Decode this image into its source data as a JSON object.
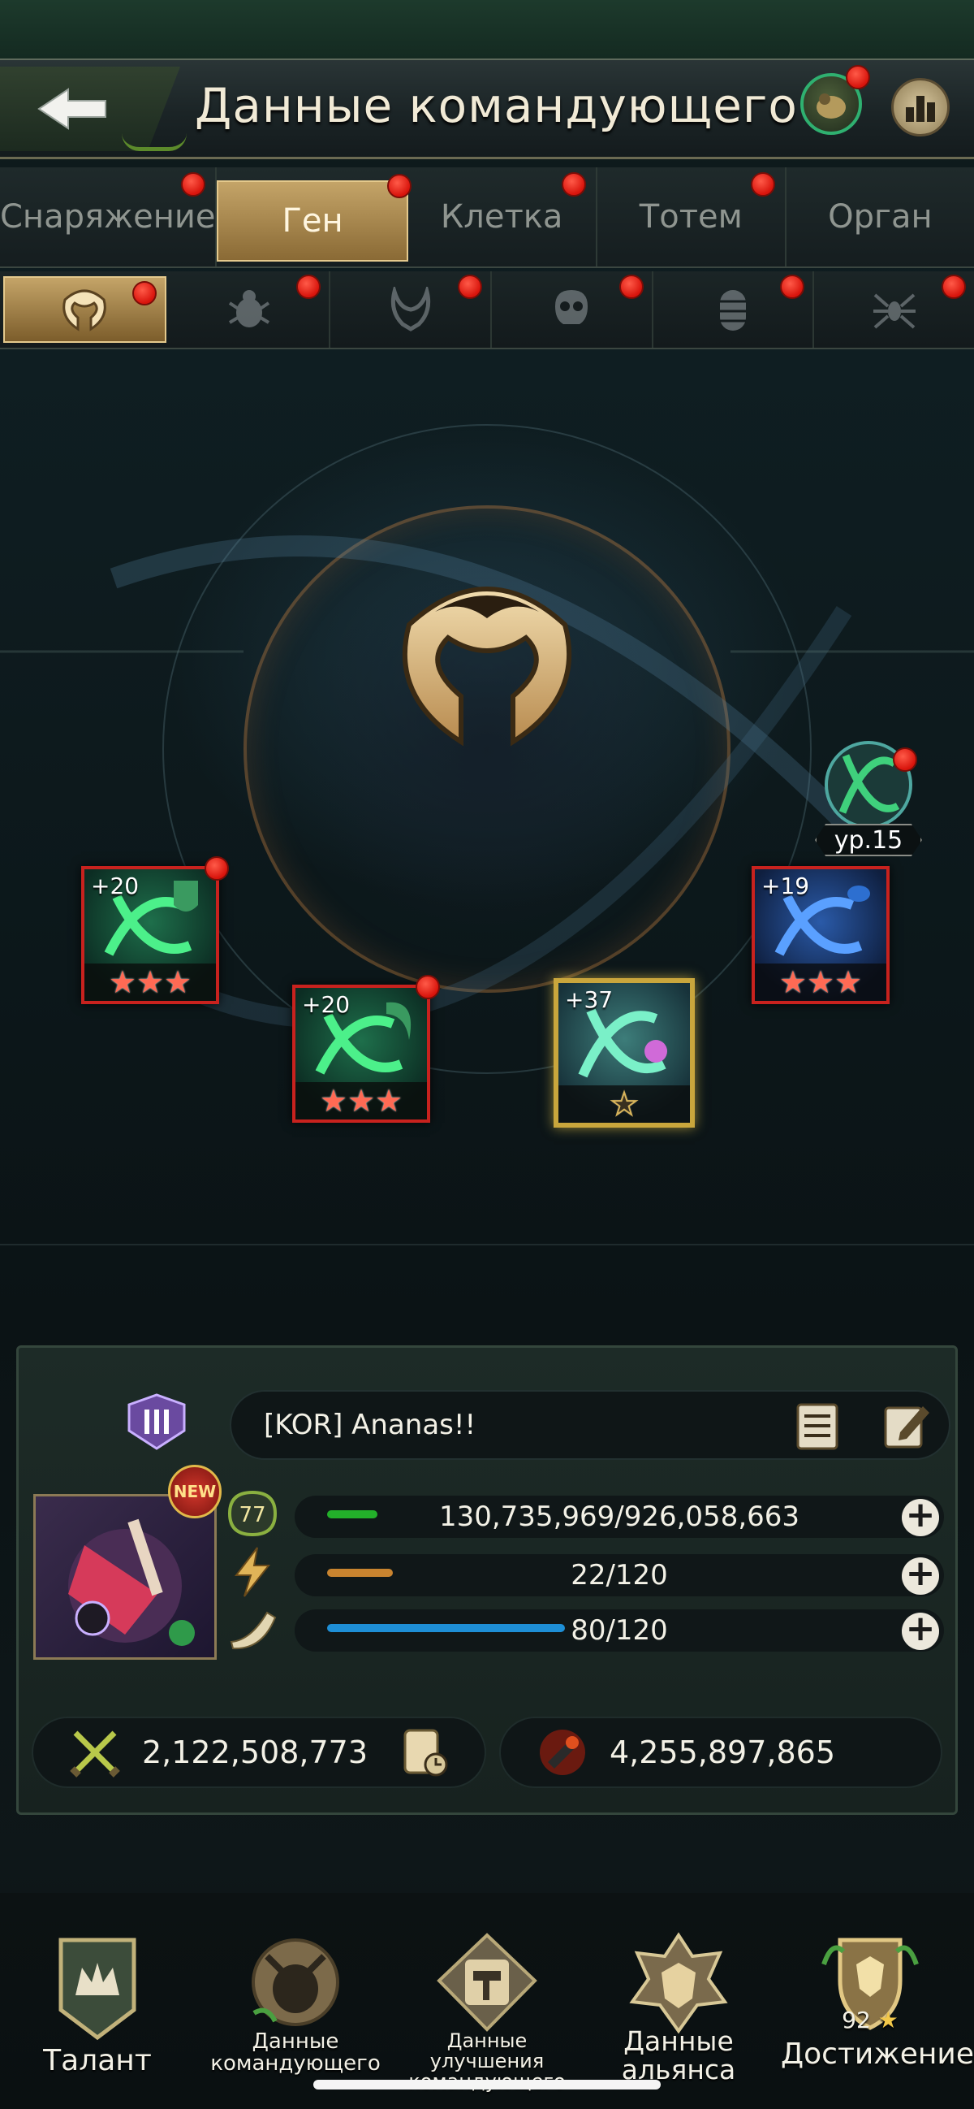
{
  "header": {
    "title": "Данные командующего"
  },
  "tabs": [
    {
      "label": "Снаряжение",
      "active": false,
      "badge": true
    },
    {
      "label": "Ген",
      "active": true,
      "badge": true
    },
    {
      "label": "Клетка",
      "active": false,
      "badge": true
    },
    {
      "label": "Тотем",
      "active": false,
      "badge": true
    },
    {
      "label": "Орган",
      "active": false,
      "badge": false
    }
  ],
  "subtabs": [
    {
      "icon": "gene-emblem-icon",
      "active": true
    },
    {
      "icon": "beetle-icon",
      "active": false
    },
    {
      "icon": "mantis-head-icon",
      "active": false
    },
    {
      "icon": "skull-ant-icon",
      "active": false
    },
    {
      "icon": "larva-icon",
      "active": false
    },
    {
      "icon": "spider-icon",
      "active": false
    }
  ],
  "gene_level": {
    "label": "ур.15"
  },
  "gene_cards": [
    {
      "level": "+20",
      "stars": 3,
      "color": "green",
      "badge": true
    },
    {
      "level": "+20",
      "stars": 3,
      "color": "green",
      "badge": true
    },
    {
      "level": "+37",
      "stars": 1,
      "color": "gold",
      "badge": false
    },
    {
      "level": "+19",
      "stars": 3,
      "color": "blue",
      "badge": false
    }
  ],
  "commander": {
    "rank_icon": "rank-roman-three-icon",
    "name": "[KOR]  Ananas!!",
    "new_label": "NEW",
    "stats": [
      {
        "icon": "level-77-badge-icon",
        "badge_text": "77",
        "text": "130,735,969/926,058,663",
        "fill_fraction": 0.141,
        "color": "#23b02a"
      },
      {
        "icon": "lightning-icon",
        "text": "22/120",
        "fill_fraction": 0.183,
        "color": "#c9842f"
      },
      {
        "icon": "horn-icon",
        "text": "80/120",
        "fill_fraction": 0.667,
        "color": "#1e8fd6"
      }
    ],
    "power": "2,122,508,773",
    "kills": "4,255,897,865"
  },
  "bottom_nav": [
    {
      "label": "Талант"
    },
    {
      "label": "Данные командующего"
    },
    {
      "label": "Данные улучшения командующего"
    },
    {
      "label": "Данные альянса"
    },
    {
      "label": "Достижение",
      "count": "92"
    }
  ],
  "colors": {
    "accent_gold": "#c4a468",
    "badge_red": "#e01a10",
    "hp_green": "#23b02a",
    "energy_orange": "#c9842f",
    "horn_blue": "#1e8fd6"
  }
}
